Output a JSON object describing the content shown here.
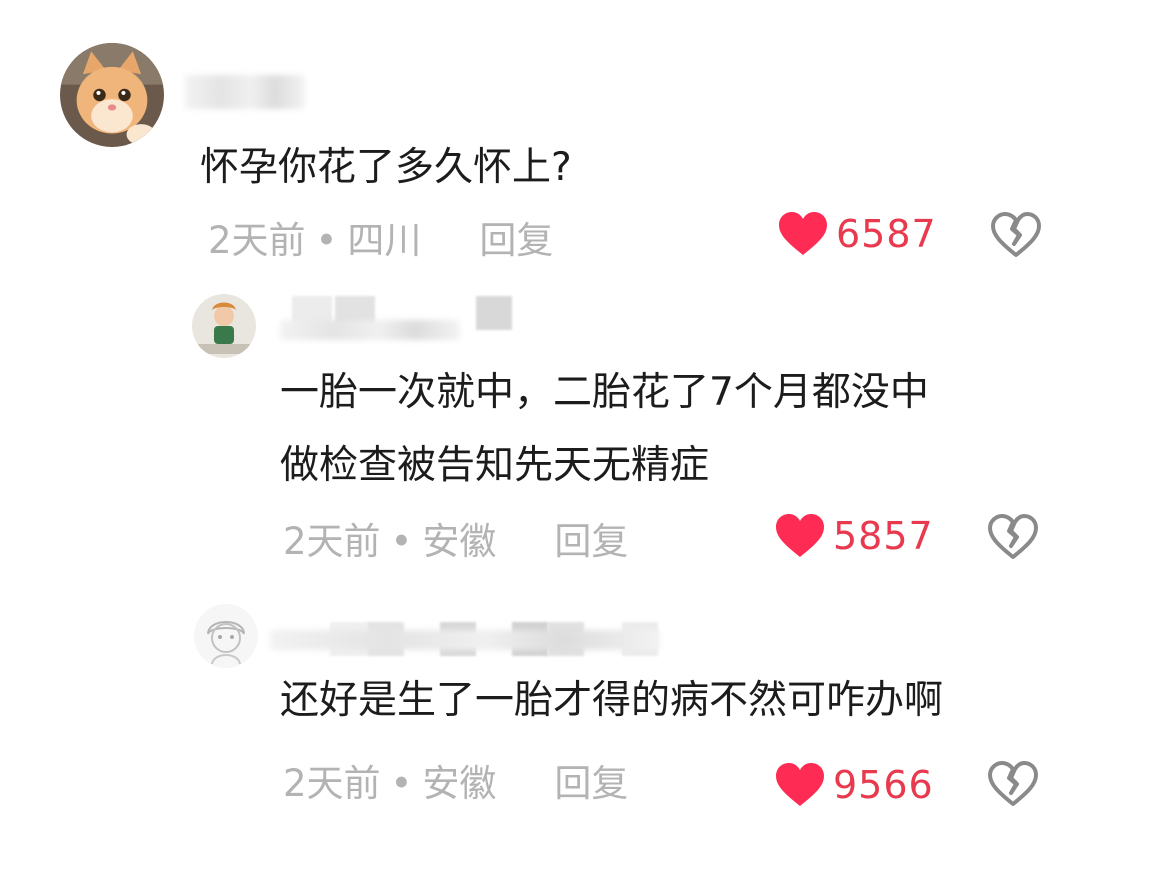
{
  "comments": [
    {
      "author": "",
      "text_lines": [
        "怀孕你花了多久怀上?"
      ],
      "time": "2天前",
      "location": "四川",
      "reply_label": "回复",
      "likes": "6587"
    },
    {
      "author": "",
      "text_lines": [
        "一胎一次就中，二胎花了7个月都没中",
        "做检查被告知先天无精症"
      ],
      "time": "2天前",
      "location": "安徽",
      "reply_label": "回复",
      "likes": "5857"
    },
    {
      "author": "",
      "text_lines": [
        "还好是生了一胎才得的病不然可咋办啊"
      ],
      "time": "2天前",
      "location": "安徽",
      "reply_label": "回复",
      "likes": "9566"
    }
  ],
  "meta_separator": "•",
  "icons": {
    "like": "heart-icon",
    "dislike": "broken-heart-icon"
  },
  "colors": {
    "like": "#fe2c55",
    "like_count": "#e8394e",
    "meta": "#b3b3b3",
    "text": "#1c1c1c"
  }
}
